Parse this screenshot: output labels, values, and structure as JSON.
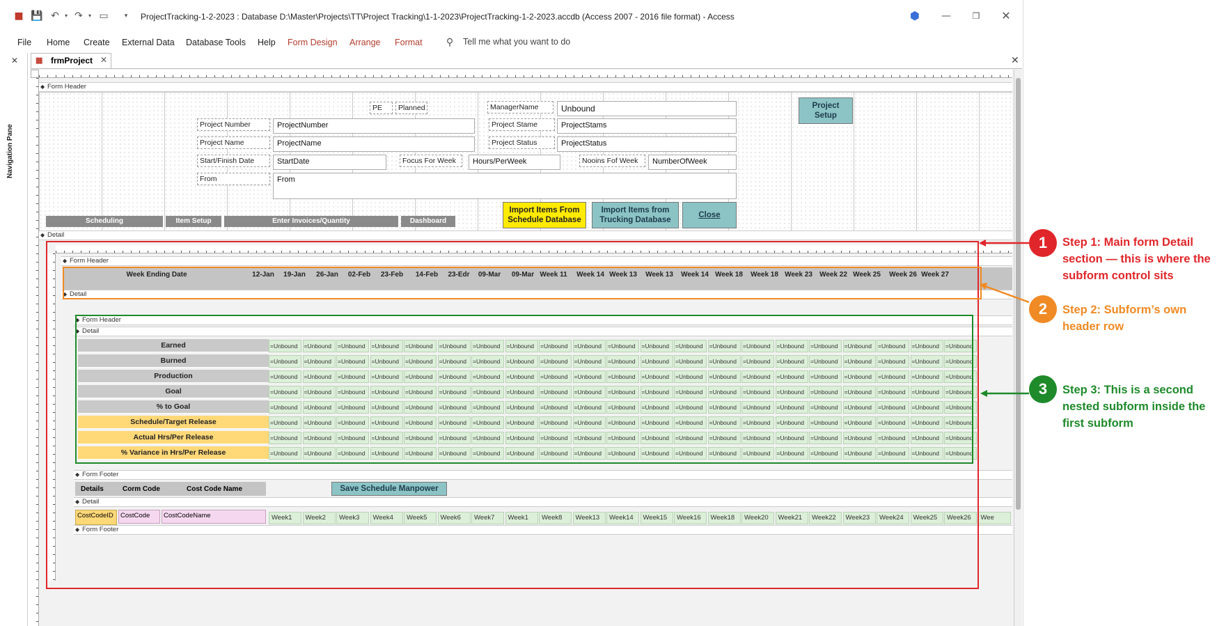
{
  "window": {
    "title": "ProjectTracking-1-2-2023 : Database  D:\\Master\\Projects\\TT\\Project Tracking\\1-1-2023\\ProjectTracking-1-2-2023.accdb (Access 2007 - 2016 file format)  -  Access",
    "minimize_icon": "minimize-icon",
    "restore_icon": "restore-icon",
    "close_icon": "close-icon"
  },
  "ribbon": {
    "tabs": [
      "File",
      "Home",
      "Create",
      "External Data",
      "Database Tools",
      "Help",
      "Form Design",
      "Arrange",
      "Format"
    ],
    "tell_me": "Tell me what you want to do"
  },
  "nav_pane": {
    "label": "Navigation Pane"
  },
  "document": {
    "tab": "frmProject"
  },
  "main_form": {
    "header_section": "Form Header",
    "detail_section": "Detail",
    "labels": {
      "pe": "PE",
      "planned": "Planned",
      "manager_name": "ManagerName",
      "project_number": "Project Number",
      "project_stame": "Project Stame",
      "project_name": "Project Name",
      "project_status": "Project Status",
      "start_finish": "Start/Finish Date",
      "focus_for_week": "Focus For Week",
      "nooins_of_week": "Nooins Fof Week",
      "from": "From"
    },
    "fields": {
      "unbound": "Unbound",
      "project_number": "ProjectNumber",
      "project_stams": "ProjectStams",
      "project_name": "ProjectName",
      "project_status": "ProjectStatus",
      "start_date": "StartDate",
      "hours_per_week": "Hours/PerWeek",
      "number_of_week": "NumberOfWeek",
      "from": "From"
    },
    "buttons": {
      "project_setup": "Project Setup",
      "import_schedule": "Import Items From Schedule Database",
      "import_trucking": "Import Items from Trucking Database",
      "close": "Close"
    },
    "tabs": [
      "Scheduling",
      "Item Setup",
      "Enter Invoices/Quantity",
      "Dashboard"
    ]
  },
  "subform1": {
    "header_section": "Form Header",
    "detail_section": "Detail",
    "week_ending_label": "Week Ending Date",
    "weeks": [
      "12-Jan",
      "19-Jan",
      "26-Jan",
      "02-Feb",
      "23-Feb",
      "14-Feb",
      "23-Edr",
      "09-Mar",
      "09-Mar",
      "Week 11",
      "Week 14",
      "Week 13",
      "Week 13",
      "Week 14",
      "Week 18",
      "Week 18",
      "Week 23",
      "Week 22",
      "Week 25",
      "Week 26",
      "Week 27"
    ]
  },
  "subform2": {
    "header_section": "Form Header",
    "detail_section": "Detail",
    "footer_section": "Form Footer",
    "row_labels": [
      "Earned",
      "Burned",
      "Production",
      "Goal",
      "% to Goal",
      "Schedule/Target Release",
      "Actual Hrs/Per Release",
      "% Variance in Hrs/Per Release"
    ],
    "cell_value": "=Unbound",
    "row_colors": [
      "#c9c9c9",
      "#c9c9c9",
      "#c9c9c9",
      "#c9c9c9",
      "#c9c9c9",
      "#ffd878",
      "#ffd878",
      "#ffd878"
    ]
  },
  "subform3": {
    "header_labels": [
      "Details",
      "Corm Code",
      "Cost Code Name"
    ],
    "save_button": "Save Schedule Manpower",
    "detail_section": "Detail",
    "footer_section": "Form Footer",
    "fields": [
      "CostCodeID",
      "CostCode",
      "CostCodeName"
    ],
    "weeks": [
      "Week1",
      "Week2",
      "Week3",
      "Week4",
      "Week5",
      "Week6",
      "Week7",
      "Week1",
      "Week8",
      "Week13",
      "Week14",
      "Week15",
      "Week16",
      "Week18",
      "Week20",
      "Week21",
      "Week22",
      "Week23",
      "Week24",
      "Week25",
      "Week26",
      "Wee"
    ]
  },
  "annotations": [
    {
      "number": "1",
      "text": "Step 1: Main form Detail section — this is where the subform control sits",
      "color": "#e0262a"
    },
    {
      "number": "2",
      "text": "Step 2: Subform’s own header row",
      "color": "#f08a24"
    },
    {
      "number": "3",
      "text": "Step 3: This is a second nested subform inside the first subform",
      "color": "#1e8a2a"
    }
  ]
}
